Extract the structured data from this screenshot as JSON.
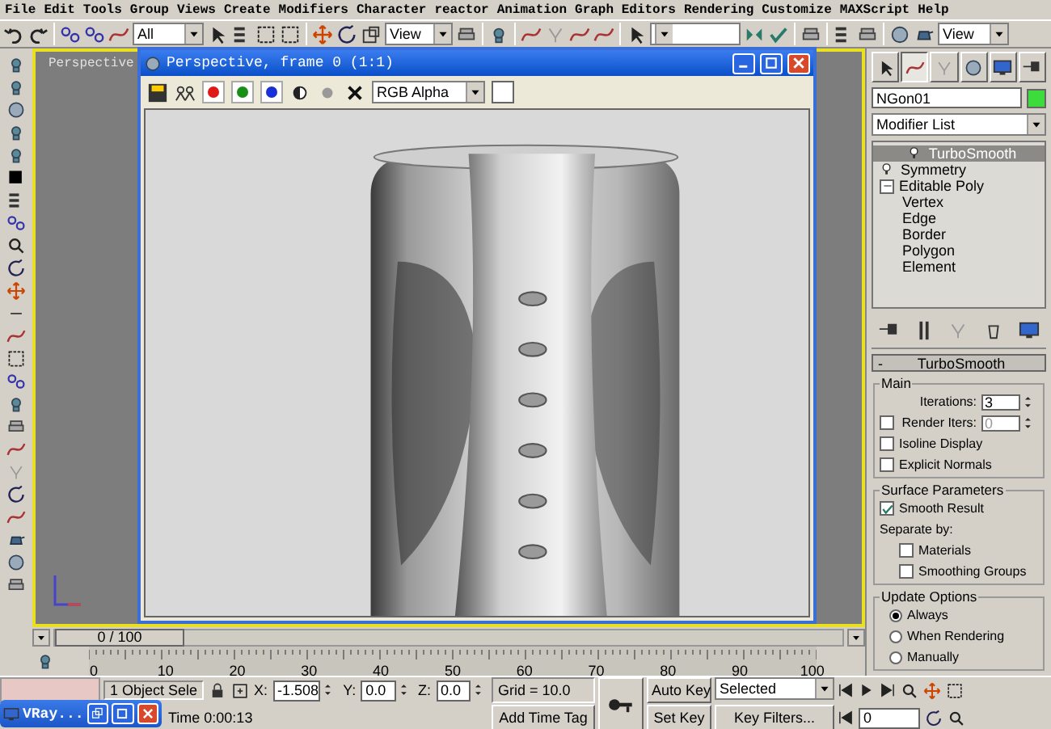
{
  "menu": [
    "File",
    "Edit",
    "Tools",
    "Group",
    "Views",
    "Create",
    "Modifiers",
    "Character",
    "reactor",
    "Animation",
    "Graph Editors",
    "Rendering",
    "Customize",
    "MAXScript",
    "Help"
  ],
  "toolbar": {
    "selection_filter": "All",
    "reference_coordinate_system": "View",
    "render_preset": "View"
  },
  "viewport": {
    "label": "Perspective"
  },
  "render_window": {
    "title": "Perspective, frame 0 (1:1)",
    "display_channel": "RGB Alpha",
    "channels": [
      {
        "color": "#e01818",
        "on": true
      },
      {
        "color": "#189018",
        "on": true
      },
      {
        "color": "#1830d8",
        "on": true
      }
    ]
  },
  "command_panel": {
    "tabs": [
      {
        "selected": false
      },
      {
        "selected": true
      },
      {
        "selected": false
      },
      {
        "selected": false
      },
      {
        "selected": false
      },
      {
        "selected": false
      }
    ],
    "object_name": "NGon01",
    "object_swatch": {
      "color": "#3ddc3d"
    },
    "modifier_list": "Modifier List",
    "stack": [
      {
        "label": "TurboSmooth",
        "selected": true
      },
      {
        "label": "Symmetry",
        "selected": false
      },
      {
        "label": "Editable Poly",
        "selected": false,
        "expanded": true,
        "children": [
          {
            "label": "Vertex"
          },
          {
            "label": "Edge"
          },
          {
            "label": "Border"
          },
          {
            "label": "Polygon"
          },
          {
            "label": "Element"
          }
        ]
      }
    ],
    "rollout": {
      "title": "TurboSmooth",
      "collapse": "-",
      "main": {
        "title": "Main",
        "iterations": {
          "label": "Iterations:",
          "value": "3"
        },
        "render_iters": {
          "label": "Render Iters:",
          "value": "0",
          "checked": false
        },
        "options": [
          {
            "label": "Isoline Display",
            "checked": false
          },
          {
            "label": "Explicit Normals",
            "checked": false
          }
        ]
      },
      "surface": {
        "title": "Surface Parameters",
        "smooth_result": {
          "label": "Smooth Result",
          "checked": true
        },
        "separate_by": "Separate by:",
        "options": [
          {
            "label": "Materials",
            "checked": false
          },
          {
            "label": "Smoothing Groups",
            "checked": false
          }
        ]
      },
      "update": {
        "title": "Update Options",
        "options": [
          {
            "label": "Always",
            "selected": true
          },
          {
            "label": "When Rendering",
            "selected": false
          },
          {
            "label": "Manually",
            "selected": false
          }
        ]
      }
    }
  },
  "timeline": {
    "position": "0 / 100",
    "level": 0,
    "ticks": [
      "0",
      "10",
      "20",
      "30",
      "40",
      "50",
      "60",
      "70",
      "80",
      "90",
      "100"
    ]
  },
  "status": {
    "selection": "1 Object Sele",
    "coords": [
      {
        "axis": "X:",
        "value": "-1.508"
      },
      {
        "axis": "Y:",
        "value": "0.0"
      },
      {
        "axis": "Z:",
        "value": "0.0"
      }
    ],
    "grid": "Grid = 10.0",
    "prompt": "Time  0:00:13",
    "add_time_tag": "Add Time Tag",
    "auto_key": "Auto Key",
    "set_key": "Set Key",
    "key_mode": "Selected",
    "key_filters": "Key Filters...",
    "frame": "0"
  },
  "taskbar": {
    "label": "VRay..."
  }
}
